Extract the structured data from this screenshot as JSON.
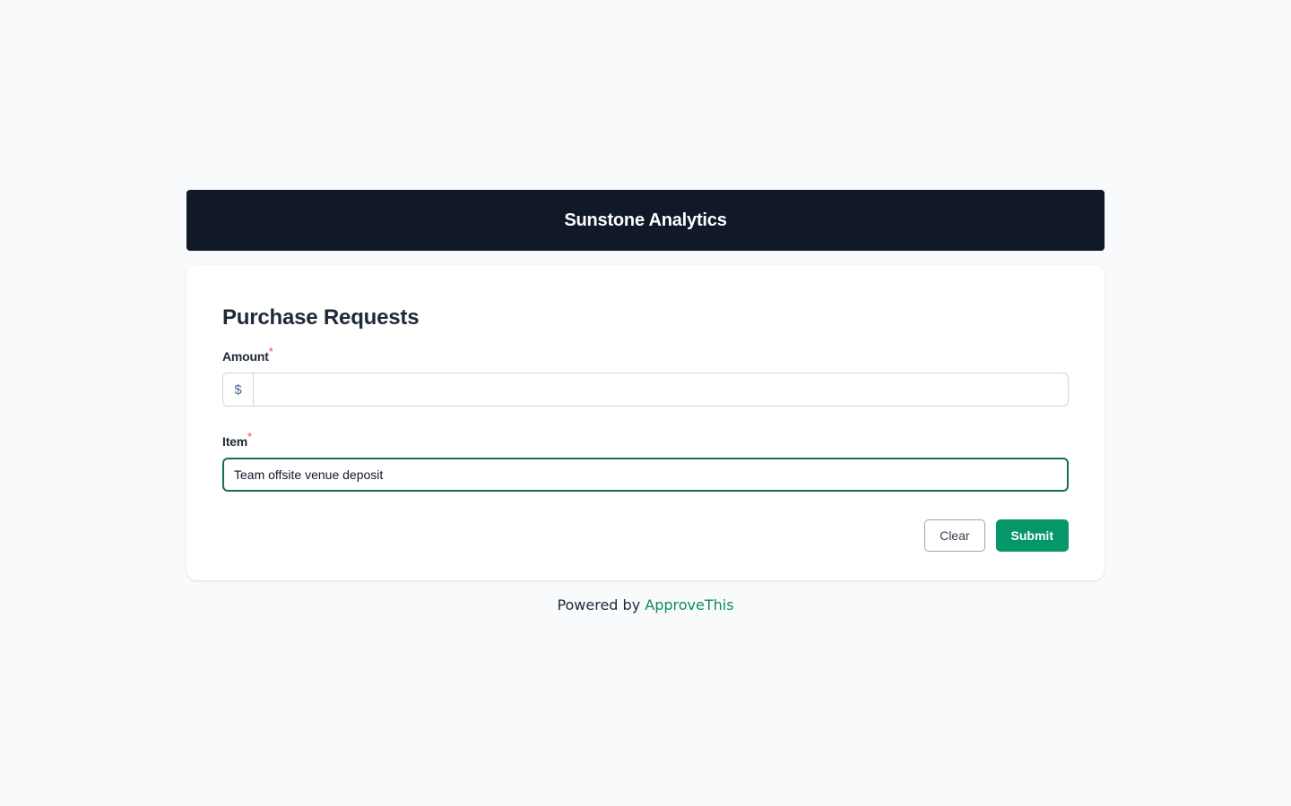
{
  "header": {
    "brand": "Sunstone Analytics"
  },
  "form": {
    "title": "Purchase Requests",
    "required_marker": "*",
    "amount": {
      "label": "Amount",
      "prefix": "$",
      "value": "",
      "placeholder": ""
    },
    "item": {
      "label": "Item",
      "value": "Team offsite venue deposit",
      "placeholder": ""
    },
    "clear_label": "Clear",
    "submit_label": "Submit"
  },
  "footer": {
    "prefix": "Powered by",
    "link": "ApproveThis"
  },
  "colors": {
    "header_bg": "#111827",
    "accent": "#059669",
    "focus_border": "#166e52",
    "required": "#ef4444"
  }
}
